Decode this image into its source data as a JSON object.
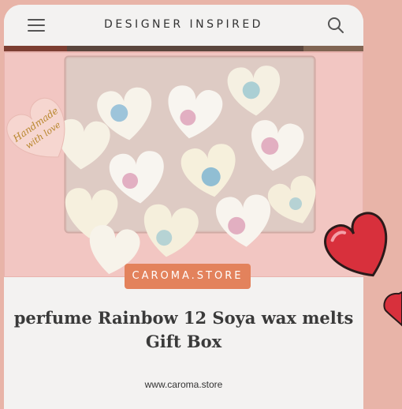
{
  "header": {
    "title": "DESIGNER INSPIRED",
    "menu_icon": "hamburger-menu-icon",
    "search_icon": "search-icon"
  },
  "hero": {
    "sticker_line1": "Handmade",
    "sticker_line2": "with love"
  },
  "brand_tag": "CAROMA.STORE",
  "product": {
    "title_line1": "perfume Rainbow 12 Soya wax melts",
    "title_line2": "Gift Box"
  },
  "footer": {
    "url": "www.caroma.store"
  },
  "colors": {
    "background": "#e8b4a8",
    "card": "#f3f2f1",
    "accent": "#e3825c",
    "box_pink": "#f2c6c2",
    "heart_red": "#d8303c"
  }
}
